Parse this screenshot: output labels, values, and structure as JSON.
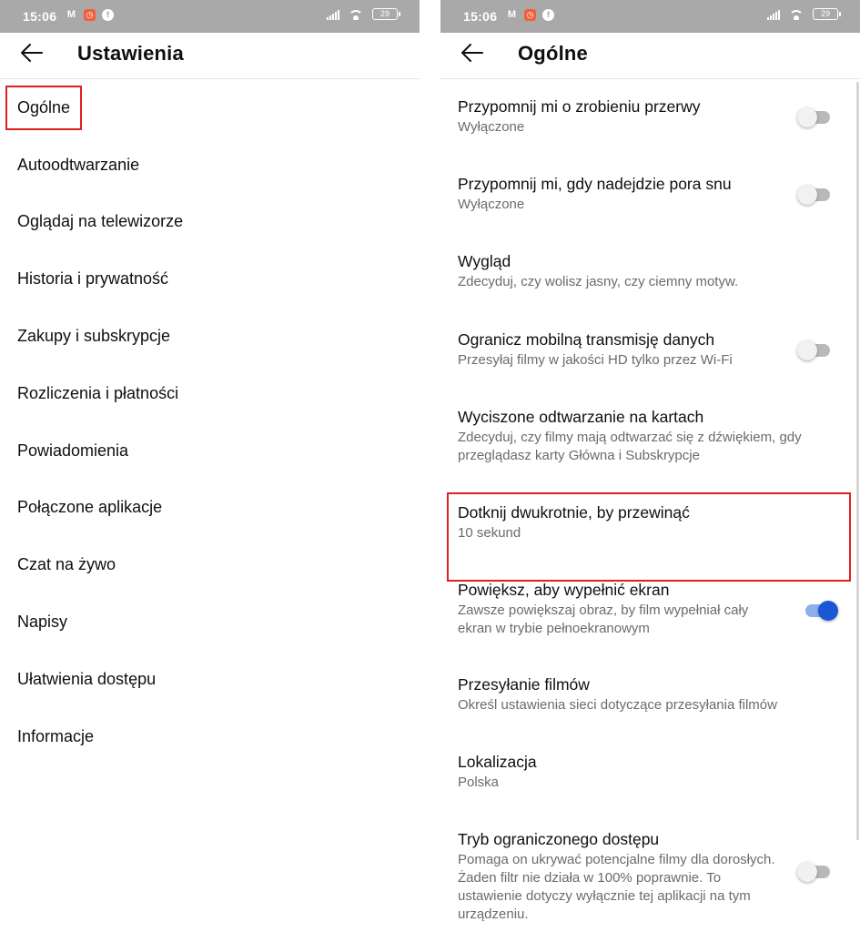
{
  "status_bar": {
    "time": "15:06",
    "battery": "29",
    "icons_left": [
      "gmail-icon",
      "clock-icon",
      "facebook-icon"
    ],
    "icons_right": [
      "signal-icon",
      "wifi-icon",
      "battery-icon"
    ]
  },
  "left_screen": {
    "title": "Ustawienia",
    "items": [
      {
        "label": "Ogólne",
        "highlighted": true
      },
      {
        "label": "Autoodtwarzanie"
      },
      {
        "label": "Oglądaj na telewizorze"
      },
      {
        "label": "Historia i prywatność"
      },
      {
        "label": "Zakupy i subskrypcje"
      },
      {
        "label": "Rozliczenia i płatności"
      },
      {
        "label": "Powiadomienia"
      },
      {
        "label": "Połączone aplikacje"
      },
      {
        "label": "Czat na żywo"
      },
      {
        "label": "Napisy"
      },
      {
        "label": "Ułatwienia dostępu"
      },
      {
        "label": "Informacje"
      }
    ]
  },
  "right_screen": {
    "title": "Ogólne",
    "settings": [
      {
        "title": "Przypomnij mi o zrobieniu przerwy",
        "subtitle": "Wyłączone",
        "toggle": false
      },
      {
        "title": "Przypomnij mi, gdy nadejdzie pora snu",
        "subtitle": "Wyłączone",
        "toggle": false
      },
      {
        "title": "Wygląd",
        "subtitle": "Zdecyduj, czy wolisz jasny, czy ciemny motyw."
      },
      {
        "title": "Ogranicz mobilną transmisję danych",
        "subtitle": "Przesyłaj filmy w jakości HD tylko przez Wi-Fi",
        "toggle": false
      },
      {
        "title": "Wyciszone odtwarzanie na kartach",
        "subtitle": "Zdecyduj, czy filmy mają odtwarzać się z dźwiękiem, gdy przeglądasz karty Główna i Subskrypcje"
      },
      {
        "title": "Dotknij dwukrotnie, by przewinąć",
        "subtitle": "10 sekund"
      },
      {
        "title": "Powiększ, aby wypełnić ekran",
        "subtitle": "Zawsze powiększaj obraz, by film wypełniał cały ekran w trybie pełnoekranowym",
        "toggle": true,
        "highlighted": true
      },
      {
        "title": "Przesyłanie filmów",
        "subtitle": "Określ ustawienia sieci dotyczące przesyłania filmów"
      },
      {
        "title": "Lokalizacja",
        "subtitle": "Polska"
      },
      {
        "title": "Tryb ograniczonego dostępu",
        "subtitle": "Pomaga on ukrywać potencjalne filmy dla dorosłych. Żaden filtr nie działa w 100% poprawnie. To ustawienie dotyczy wyłącznie tej aplikacji na tym urządzeniu.",
        "toggle": false
      }
    ]
  },
  "colors": {
    "status_bar": "#a9a9a9",
    "highlight_frame": "#e02020",
    "toggle_on": "#1a57d6",
    "toggle_off": "#b9b9b9"
  }
}
